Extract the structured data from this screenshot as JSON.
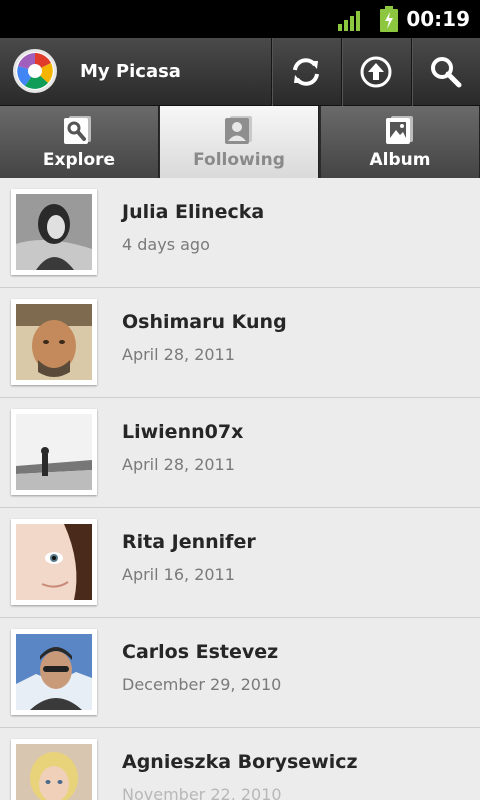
{
  "status_bar": {
    "time": "00:19"
  },
  "action_bar": {
    "title": "My Picasa",
    "buttons": [
      {
        "icon": "refresh-icon"
      },
      {
        "icon": "upload-icon"
      },
      {
        "icon": "search-icon"
      }
    ]
  },
  "tabs": [
    {
      "label": "Explore",
      "icon": "explore-icon",
      "active": false
    },
    {
      "label": "Following",
      "icon": "person-icon",
      "active": true
    },
    {
      "label": "Album",
      "icon": "album-icon",
      "active": false
    }
  ],
  "people": [
    {
      "name": "Julia Elinecka",
      "date": "4 days ago"
    },
    {
      "name": "Oshimaru Kung",
      "date": "April 28, 2011"
    },
    {
      "name": "Liwienn07x",
      "date": "April 28, 2011"
    },
    {
      "name": "Rita Jennifer",
      "date": "April 16, 2011"
    },
    {
      "name": "Carlos Estevez",
      "date": "December 29, 2010"
    },
    {
      "name": "Agnieszka Borysewicz",
      "date": "November 22, 2010"
    }
  ],
  "colors": {
    "status_bar": "#000000",
    "action_bar": "#3a3a3a",
    "list_background": "#ececec",
    "signal": "#8dc63f"
  }
}
